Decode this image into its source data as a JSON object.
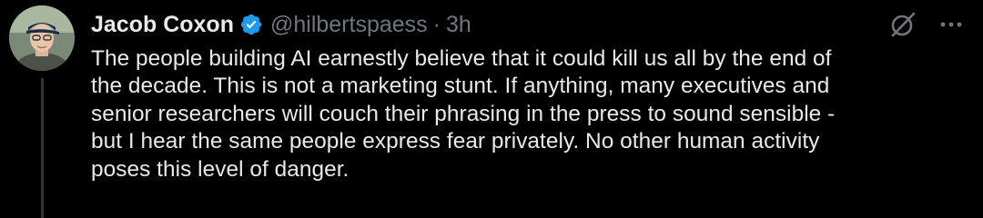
{
  "tweet": {
    "author": {
      "name": "Jacob Coxon",
      "handle": "@hilbertspaess",
      "verified": true,
      "avatar_icon": "avatar-photo"
    },
    "separator": "·",
    "time": "3h",
    "actions": {
      "grok_icon": "slashed-circle-icon",
      "more_icon": "more-horizontal-icon"
    },
    "body_lines": [
      "The people building AI earnestly believe that it could kill us all by the end of",
      "the decade. This is not a marketing stunt. If anything, many executives and",
      "senior researchers will couch their phrasing in the press to sound sensible -",
      "but I hear the same people express fear privately. No other human activity",
      "poses this level of danger."
    ]
  },
  "colors": {
    "background": "#000000",
    "text_primary": "#e7e9ea",
    "text_secondary": "#71767b",
    "verified_blue": "#1d9bf0",
    "thread_line": "#333639"
  }
}
